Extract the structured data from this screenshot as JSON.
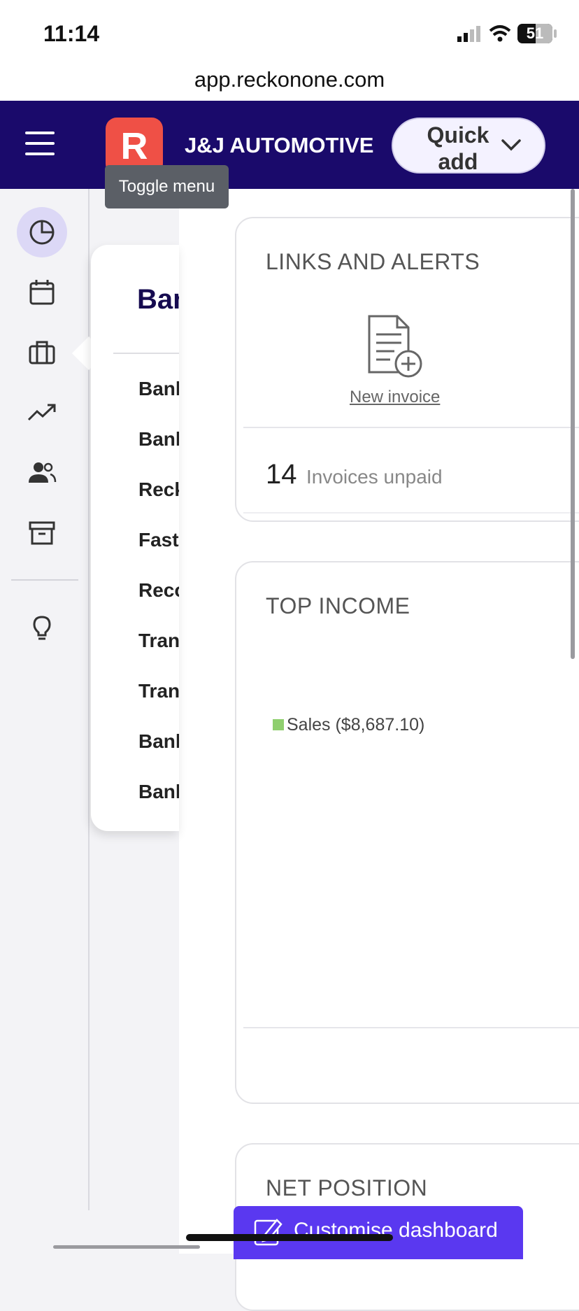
{
  "status_bar": {
    "time": "11:14",
    "battery": "51"
  },
  "browser": {
    "url": "app.reckonone.com"
  },
  "header": {
    "logo_letter": "R",
    "company_name": "J&J AUTOMOTIVE",
    "quick_add_label": "Quick add",
    "tooltip": "Toggle menu"
  },
  "sidebar": {
    "icons": [
      "dashboard-icon",
      "calendar-icon",
      "briefcase-icon",
      "trending-up-icon",
      "users-icon",
      "archive-icon",
      "lightbulb-icon"
    ],
    "active": "dashboard-icon"
  },
  "flyout": {
    "title": "Ban",
    "items": [
      "Bank",
      "Bank",
      "Reck",
      "Fast",
      "Reco",
      "Tran",
      "Tran",
      "Bank",
      "Bank"
    ]
  },
  "cards": {
    "links": {
      "title": "LINKS AND ALERTS",
      "new_invoice": "New invoice",
      "unpaid_count": "14",
      "unpaid_label": "Invoices unpaid"
    },
    "top_income": {
      "title": "TOP INCOME",
      "legend": "Sales ($8,687.10)",
      "legend_color": "#8fcf6e"
    },
    "net_position": {
      "title": "NET POSITION"
    }
  },
  "footer": {
    "customise_label": "Customise dashboard"
  },
  "colors": {
    "brand_dark": "#1a0a6b",
    "logo": "#ef5046",
    "accent": "#5a38f0"
  }
}
